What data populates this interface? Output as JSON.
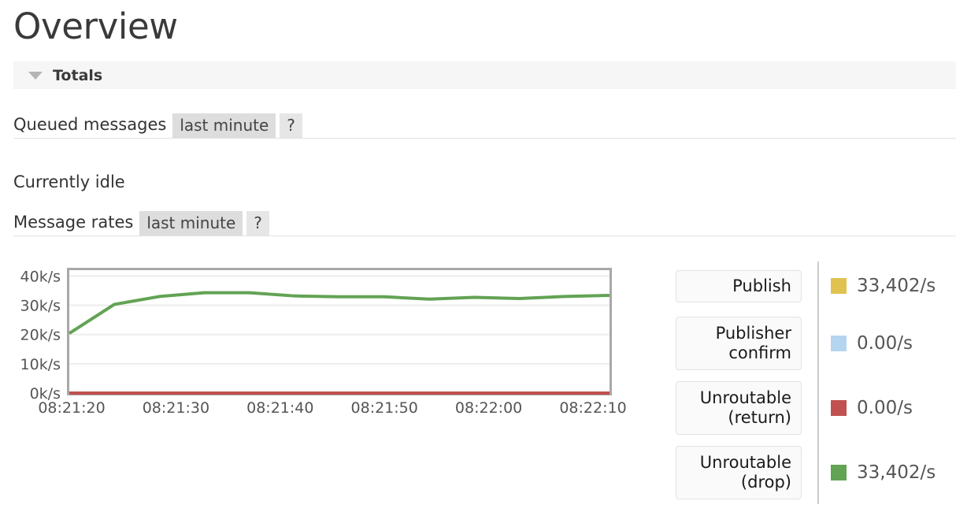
{
  "page": {
    "title": "Overview"
  },
  "section": {
    "title": "Totals",
    "toggle_icon": "triangle-down-icon"
  },
  "queued_messages": {
    "label": "Queued messages",
    "tab_active": "last minute",
    "tab_help": "?",
    "status": "Currently idle"
  },
  "message_rates": {
    "label": "Message rates",
    "tab_active": "last minute",
    "tab_help": "?"
  },
  "legend": {
    "items": [
      {
        "label": "Publish",
        "value": "33,402/s",
        "color": "#e0c24f",
        "lines": 1
      },
      {
        "label": "Publisher\nconfirm",
        "value": "0.00/s",
        "color": "#b5d4f0",
        "lines": 2
      },
      {
        "label": "Unroutable\n(return)",
        "value": "0.00/s",
        "color": "#c15050",
        "lines": 2
      },
      {
        "label": "Unroutable\n(drop)",
        "value": "33,402/s",
        "color": "#62a354",
        "lines": 2
      }
    ]
  },
  "chart_data": {
    "type": "line",
    "title": "",
    "xlabel": "",
    "ylabel": "",
    "grid": true,
    "legend_position": "right",
    "ylim": [
      0,
      42000
    ],
    "yticks": [
      0,
      10000,
      20000,
      30000,
      40000
    ],
    "ytick_labels": [
      "0k/s",
      "10k/s",
      "20k/s",
      "30k/s",
      "40k/s"
    ],
    "xtick_labels": [
      "08:21:20",
      "08:21:30",
      "08:21:40",
      "08:21:50",
      "08:22:00",
      "08:22:10"
    ],
    "x": [
      "08:21:18",
      "08:21:23",
      "08:21:28",
      "08:21:33",
      "08:21:38",
      "08:21:43",
      "08:21:48",
      "08:21:53",
      "08:21:58",
      "08:22:03",
      "08:22:08",
      "08:22:13",
      "08:22:16"
    ],
    "series": [
      {
        "name": "Unroutable (drop)",
        "color": "#62a354",
        "values": [
          20400,
          30300,
          33000,
          34300,
          34300,
          33200,
          32900,
          32900,
          32100,
          32700,
          32300,
          33000,
          33400
        ]
      },
      {
        "name": "Unroutable (return)",
        "color": "#c15050",
        "values": [
          0,
          0,
          0,
          0,
          0,
          0,
          0,
          0,
          0,
          0,
          0,
          0,
          0
        ]
      }
    ]
  }
}
